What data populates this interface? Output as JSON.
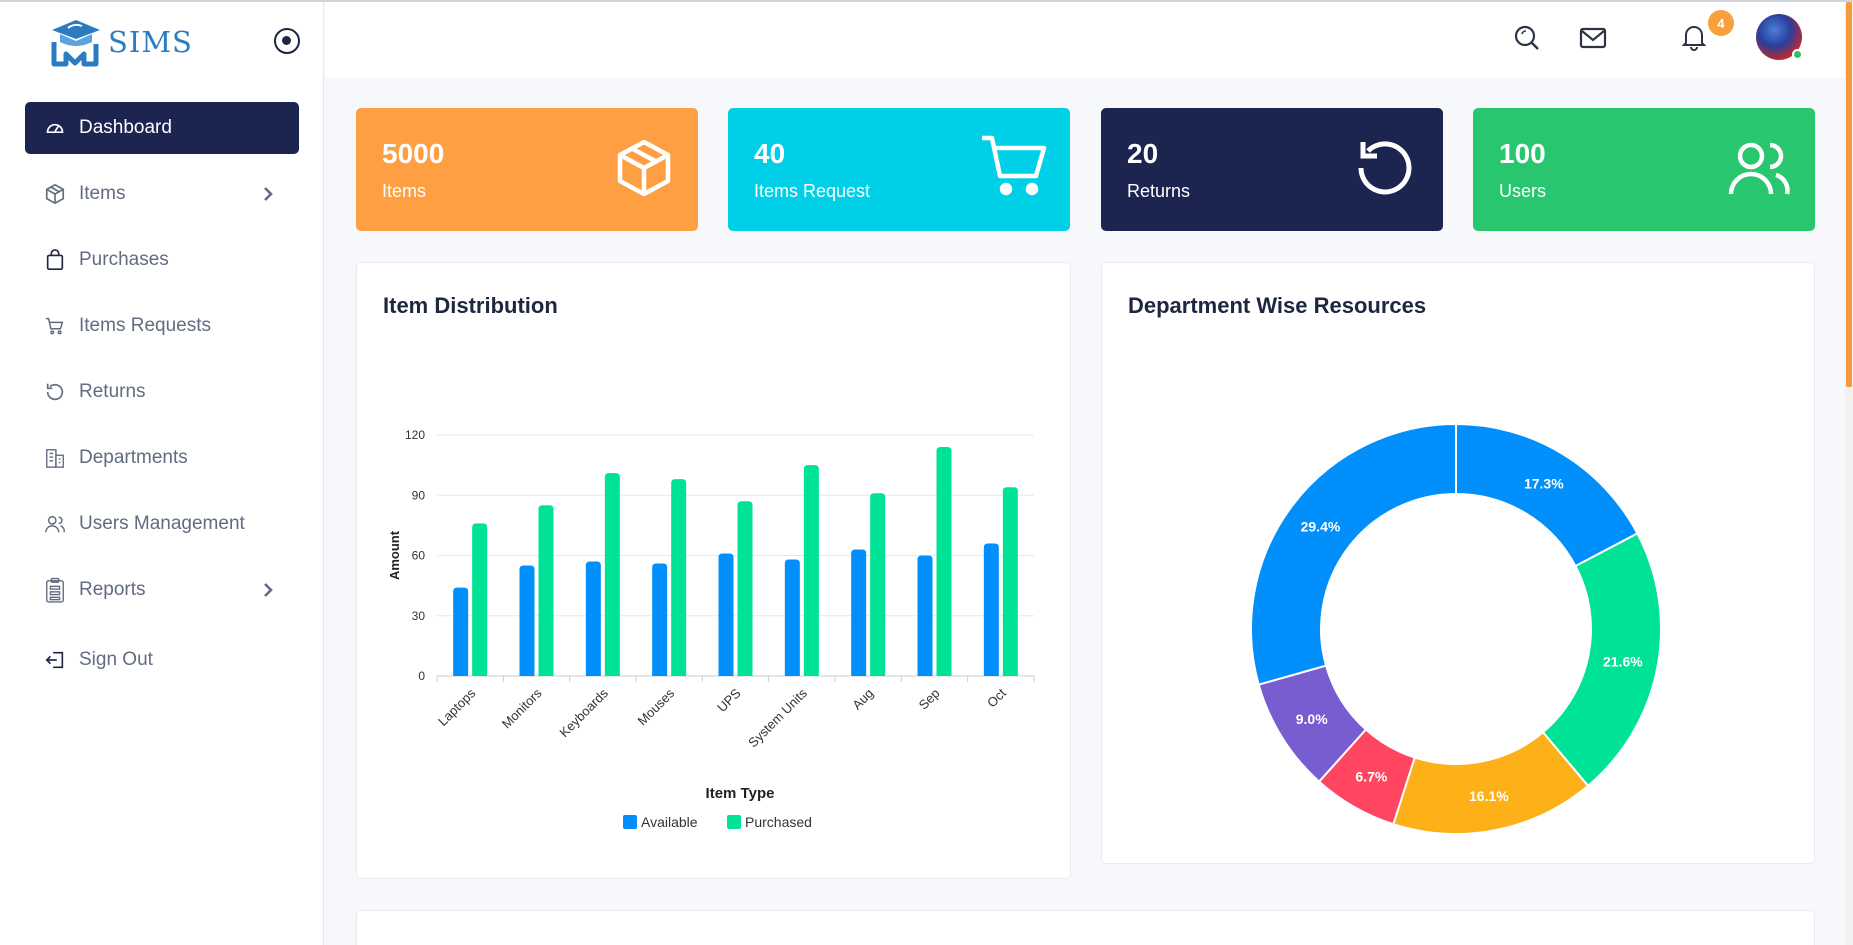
{
  "brand": {
    "name": "SIMS"
  },
  "sidebar": {
    "items": [
      {
        "label": "Dashboard",
        "icon": "dashboard-gauge-icon",
        "active": true
      },
      {
        "label": "Items",
        "icon": "box-icon",
        "has_submenu": true
      },
      {
        "label": "Purchases",
        "icon": "shopping-bag-icon"
      },
      {
        "label": "Items Requests",
        "icon": "cart-icon"
      },
      {
        "label": "Returns",
        "icon": "undo-icon"
      },
      {
        "label": "Departments",
        "icon": "building-icon"
      },
      {
        "label": "Users Management",
        "icon": "users-icon"
      },
      {
        "label": "Reports",
        "icon": "clipboard-icon",
        "has_submenu": true
      },
      {
        "label": "Sign Out",
        "icon": "sign-out-icon"
      }
    ]
  },
  "topbar": {
    "notification_count": "4",
    "icons": [
      "search-icon",
      "mail-icon",
      "bell-icon",
      "user-avatar"
    ]
  },
  "stats": [
    {
      "value": "5000",
      "label": "Items",
      "color": "#ff9f43",
      "icon": "box-icon"
    },
    {
      "value": "40",
      "label": "Items Request",
      "color": "#00cfe8",
      "icon": "cart-icon"
    },
    {
      "value": "20",
      "label": "Returns",
      "color": "#1c2450",
      "icon": "undo-icon"
    },
    {
      "value": "100",
      "label": "Users",
      "color": "#28c76f",
      "icon": "users-icon"
    }
  ],
  "colors": {
    "accent": "#1c2450",
    "available": "#008ffb",
    "purchased": "#00e396"
  },
  "chart_data": [
    {
      "type": "bar",
      "title": "Item Distribution",
      "xlabel": "Item Type",
      "ylabel": "Amount",
      "categories": [
        "Laptops",
        "Monitors",
        "Keyboards",
        "Mouses",
        "UPS",
        "System Units",
        "Aug",
        "Sep",
        "Oct"
      ],
      "series": [
        {
          "name": "Available",
          "color": "#008ffb",
          "values": [
            44,
            55,
            57,
            56,
            61,
            58,
            63,
            60,
            66
          ]
        },
        {
          "name": "Purchased",
          "color": "#00e396",
          "values": [
            76,
            85,
            101,
            98,
            87,
            105,
            91,
            114,
            94
          ]
        }
      ],
      "ylim": [
        0,
        120
      ],
      "yticks": [
        "0",
        "30",
        "60",
        "90",
        "120"
      ],
      "grid": true,
      "legend": "bottom-center"
    },
    {
      "type": "pie",
      "title": "Department Wise Resources",
      "donut": true,
      "slices": [
        {
          "label": "17.3%",
          "value": 17.3,
          "color": "#008ffb"
        },
        {
          "label": "21.6%",
          "value": 21.6,
          "color": "#00e396"
        },
        {
          "label": "16.1%",
          "value": 16.1,
          "color": "#feb019"
        },
        {
          "label": "6.7%",
          "value": 6.7,
          "color": "#ff4560"
        },
        {
          "label": "9.0%",
          "value": 9.0,
          "color": "#775dd0"
        },
        {
          "label": "29.4%",
          "value": 29.4,
          "color": "#008ffb"
        }
      ]
    }
  ]
}
